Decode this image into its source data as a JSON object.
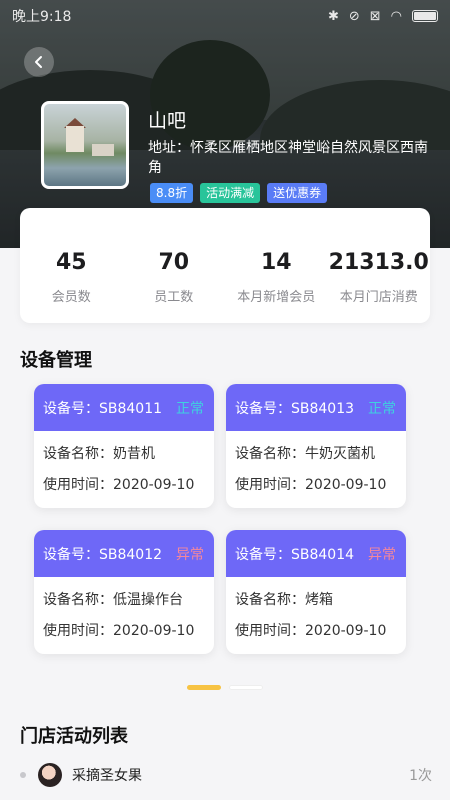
{
  "status_bar": {
    "time": "晚上9:18"
  },
  "store": {
    "name": "山吧",
    "address": "地址：怀柔区雁栖地区神堂峪自然风景区西南角",
    "tags": [
      {
        "label": "8.8折",
        "color": "#4a8df6"
      },
      {
        "label": "活动满减",
        "color": "#28c49a"
      },
      {
        "label": "送优惠券",
        "color": "#5a7cf6"
      }
    ]
  },
  "stats": [
    {
      "value": "45",
      "label": "会员数"
    },
    {
      "value": "70",
      "label": "员工数"
    },
    {
      "value": "14",
      "label": "本月新增会员"
    },
    {
      "value": "21313.0",
      "label": "本月门店消费"
    }
  ],
  "device_section": {
    "title": "设备管理",
    "devices": [
      {
        "id_label": "设备号：SB84011",
        "status": "正常",
        "name_label": "设备名称：奶昔机",
        "time_label": "使用时间：2020-09-10"
      },
      {
        "id_label": "设备号：SB84013",
        "status": "正常",
        "name_label": "设备名称：牛奶灭菌机",
        "time_label": "使用时间：2020-09-10"
      },
      {
        "id_label": "设备号：SB84012",
        "status": "异常",
        "name_label": "设备名称：低温操作台",
        "time_label": "使用时间：2020-09-10"
      },
      {
        "id_label": "设备号：SB84014",
        "status": "异常",
        "name_label": "设备名称：烤箱",
        "time_label": "使用时间：2020-09-10"
      }
    ]
  },
  "activity_section": {
    "title": "门店活动列表",
    "items": [
      {
        "name": "采摘圣女果",
        "count": "1次"
      }
    ]
  },
  "colors": {
    "accent": "#6e68f7",
    "status_ok": "#3fd0e0",
    "status_bad": "#f4879c",
    "pager_active": "#f7c343",
    "pager_inactive": "#ffffff"
  }
}
